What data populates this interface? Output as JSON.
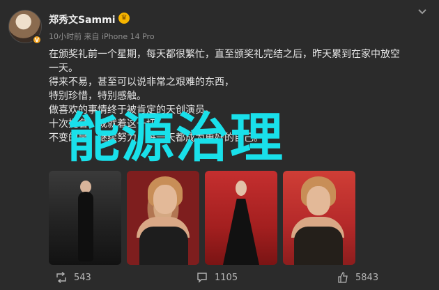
{
  "header": {
    "username": "郑秀文Sammi",
    "meta": "10小时前 来自 iPhone 14 Pro",
    "crown_icon": "crown-icon",
    "more_icon": "chevron-down-icon"
  },
  "post": {
    "text": "在颁奖礼前一个星期，每天都很繁忙，直至颁奖礼完结之后，昨天累到在家中放空\n一天。\n得来不易，甚至可以说非常之艰难的东西，\n特别珍惜，特别感触。\n做喜欢的事情终于被肯定的天创演员。\n十次提名，成就着这一切。\n不变的是，继续努力，每一天都成为更好的自己。"
  },
  "overlay": {
    "title": "能源治理"
  },
  "photos": [
    {
      "alt": "photo-1"
    },
    {
      "alt": "photo-2"
    },
    {
      "alt": "photo-3"
    },
    {
      "alt": "photo-4"
    }
  ],
  "footer": {
    "repost_count": "543",
    "comment_count": "1105",
    "like_count": "5843",
    "repost_icon": "repost-icon",
    "comment_icon": "comment-icon",
    "like_icon": "thumbs-up-icon"
  }
}
